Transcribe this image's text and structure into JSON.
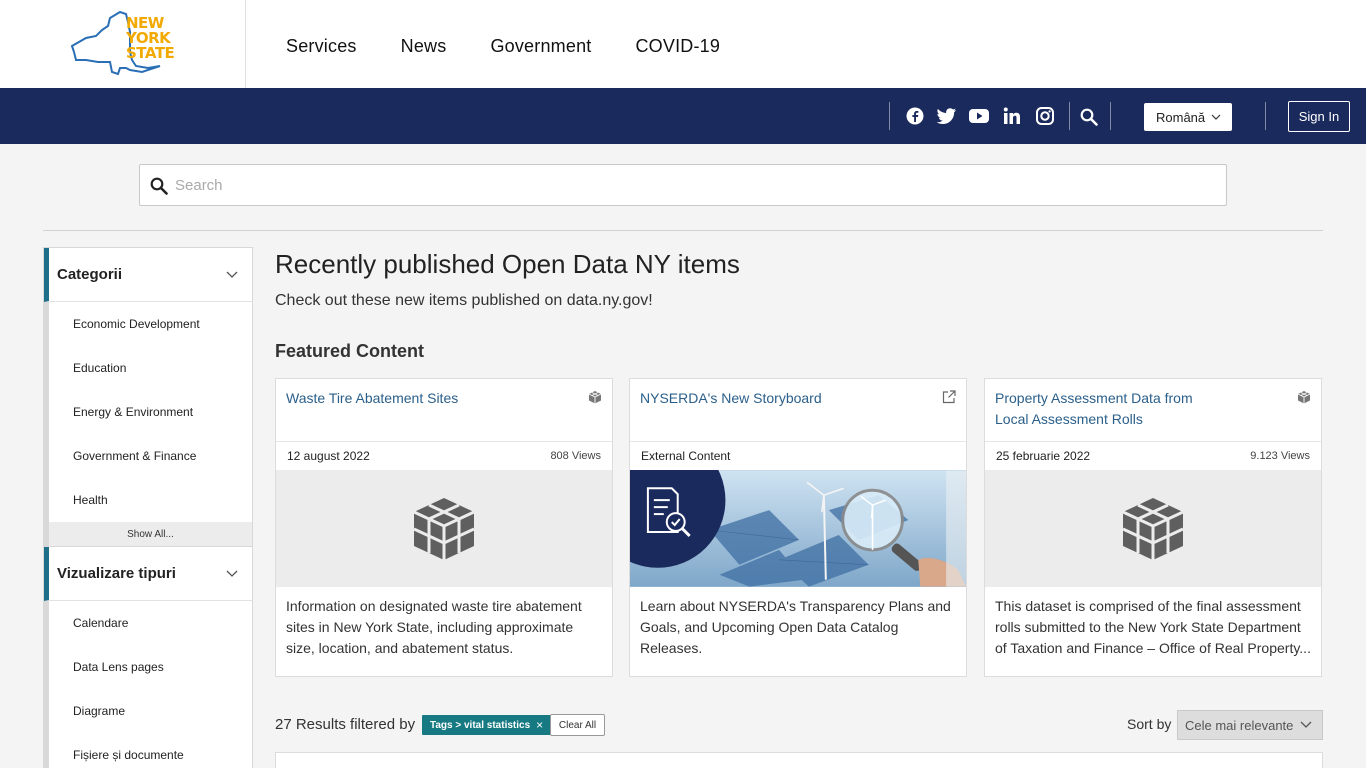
{
  "header": {
    "logo_lines": [
      "NEW",
      "YORK",
      "STATE"
    ],
    "nav": [
      "Services",
      "News",
      "Government",
      "COVID-19"
    ]
  },
  "utility": {
    "social_icons": [
      "facebook-icon",
      "twitter-icon",
      "youtube-icon",
      "linkedin-icon",
      "instagram-icon"
    ],
    "language": "Română",
    "sign_in": "Sign In"
  },
  "search": {
    "placeholder": "Search"
  },
  "sidebar": {
    "categories": {
      "title": "Categorii",
      "items": [
        "Economic Development",
        "Education",
        "Energy & Environment",
        "Government & Finance",
        "Health"
      ],
      "show_all": "Show All..."
    },
    "view_types": {
      "title": "Vizualizare tipuri",
      "items": [
        "Calendare",
        "Data Lens pages",
        "Diagrame",
        "Fișiere și documente"
      ]
    }
  },
  "main": {
    "title": "Recently published Open Data NY items",
    "subtitle": "Check out these new items published on data.ny.gov!",
    "featured_label": "Featured Content",
    "cards": [
      {
        "title": "Waste Tire Abatement Sites",
        "icon": "dataset-cube-icon",
        "date": "12 august 2022",
        "views": "808 Views",
        "description": "Information on designated waste tire abatement sites in New York State, including approximate size, location, and abatement status."
      },
      {
        "title": "NYSERDA's New Storyboard",
        "icon": "external-link-icon",
        "date": "External Content",
        "views": "",
        "description": "Learn about NYSERDA's Transparency Plans and Goals, and Upcoming Open Data Catalog Releases."
      },
      {
        "title": "Property Assessment Data from Local Assessment Rolls",
        "icon": "dataset-cube-icon",
        "date": "25 februarie 2022",
        "views": "9.123 Views",
        "description": "This dataset is comprised of the final assessment rolls submitted to the New York State Department of Taxation and Finance – Office of Real Property..."
      }
    ],
    "results": {
      "count_text": "27 Results filtered by",
      "tag": "Tags > vital statistics",
      "clear_all": "Clear All",
      "sort_label": "Sort by",
      "sort_value": "Cele mai relevante"
    }
  },
  "colors": {
    "blue_bar": "#1b2a5c",
    "accent_teal": "#177a83",
    "logo_blue": "#2a6fb5",
    "logo_gold": "#f2a900",
    "link_blue": "#2b5f8a"
  }
}
